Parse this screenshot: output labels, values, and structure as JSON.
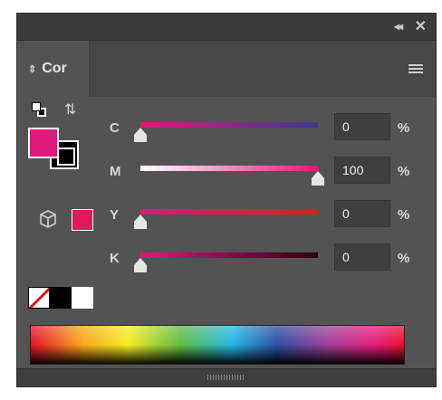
{
  "header": {
    "collapse_glyph": "◂◂",
    "close_glyph": "✕"
  },
  "tab": {
    "label": "Cor",
    "arrow_glyph": "⇕"
  },
  "colors": {
    "fill": "#e0197d",
    "gamut_warning": "#e0195d"
  },
  "sliders": [
    {
      "label": "C",
      "value": "0",
      "unit": "%",
      "level": 0
    },
    {
      "label": "M",
      "value": "100",
      "unit": "%",
      "level": 100
    },
    {
      "label": "Y",
      "value": "0",
      "unit": "%",
      "level": 0
    },
    {
      "label": "K",
      "value": "0",
      "unit": "%",
      "level": 0
    }
  ],
  "icons": {
    "swap": "swap-arrows-icon",
    "default": "default-fill-stroke-icon",
    "gamut": "cube-icon",
    "menu": "hamburger-icon"
  }
}
